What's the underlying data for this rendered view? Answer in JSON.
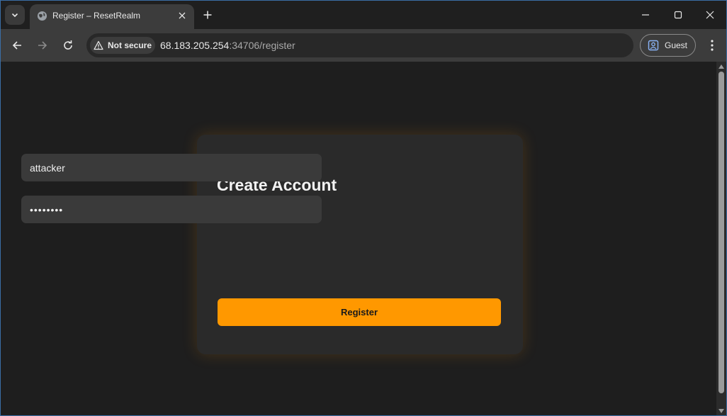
{
  "browser": {
    "tab": {
      "title": "Register – ResetRealm"
    },
    "address_bar": {
      "security_label": "Not secure",
      "url_host": "68.183.205.254",
      "url_rest": ":34706/register"
    },
    "profile": {
      "label": "Guest"
    }
  },
  "page": {
    "title": "Create Account",
    "username_value": "attacker",
    "password_value": "••••••••",
    "submit_label": "Register"
  },
  "colors": {
    "accent": "#ff9800",
    "card_bg": "#2a2a2a",
    "page_bg": "#1e1e1e"
  }
}
